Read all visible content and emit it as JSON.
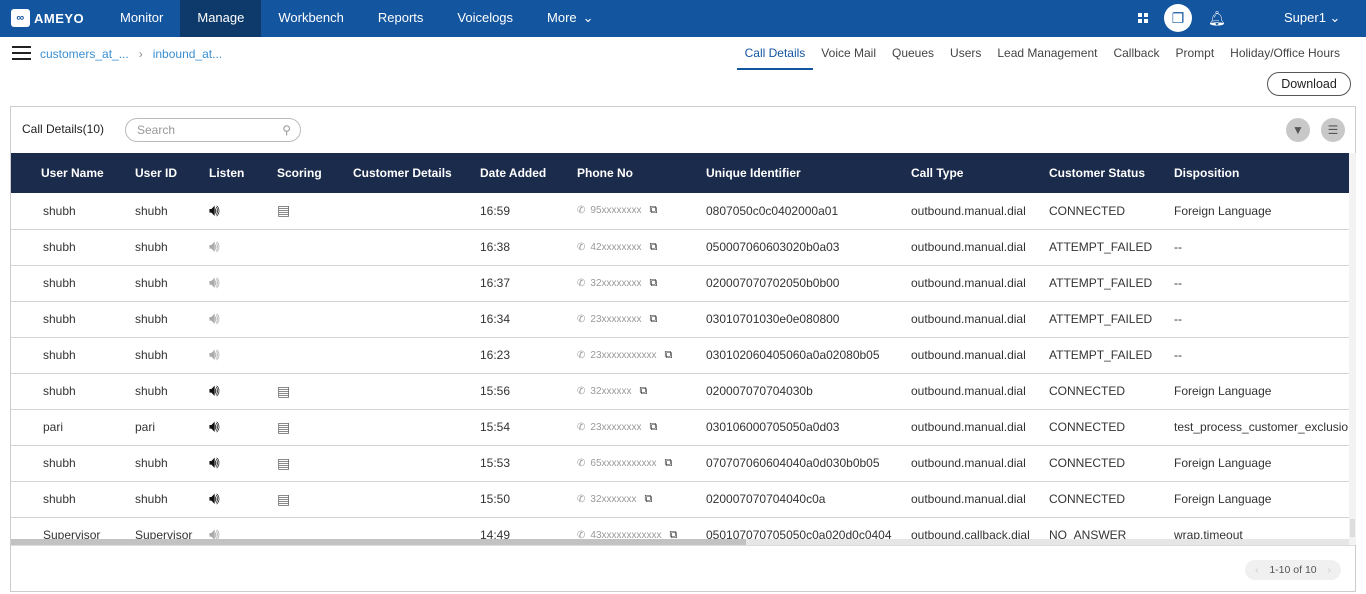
{
  "topbar": {
    "logo": "AMEYO",
    "nav": [
      "Monitor",
      "Manage",
      "Workbench",
      "Reports",
      "Voicelogs",
      "More"
    ],
    "active": "Manage",
    "user": "Super1"
  },
  "breadcrumb": [
    "customers_at_...",
    "inbound_at..."
  ],
  "tabs": [
    "Call Details",
    "Voice Mail",
    "Queues",
    "Users",
    "Lead Management",
    "Callback",
    "Prompt",
    "Holiday/Office Hours"
  ],
  "active_tab": "Call Details",
  "download_label": "Download",
  "card": {
    "title": "Call Details(10)",
    "search_placeholder": "Search"
  },
  "columns": [
    "User Name",
    "User ID",
    "Listen",
    "Scoring",
    "Customer Details",
    "Date Added",
    "Phone No",
    "Unique Identifier",
    "Call Type",
    "Customer Status",
    "Disposition"
  ],
  "rows": [
    {
      "user_name": "shubh",
      "user_id": "shubh",
      "listen_enabled": true,
      "scoring": true,
      "customer_details": "",
      "date_added": "16:59",
      "phone": "95xxxxxxxx",
      "uid": "0807050c0c0402000a01",
      "call_type": "outbound.manual.dial",
      "status": "CONNECTED",
      "disposition": "Foreign Language"
    },
    {
      "user_name": "shubh",
      "user_id": "shubh",
      "listen_enabled": false,
      "scoring": false,
      "customer_details": "",
      "date_added": "16:38",
      "phone": "42xxxxxxxx",
      "uid": "050007060603020b0a03",
      "call_type": "outbound.manual.dial",
      "status": "ATTEMPT_FAILED",
      "disposition": "--"
    },
    {
      "user_name": "shubh",
      "user_id": "shubh",
      "listen_enabled": false,
      "scoring": false,
      "customer_details": "",
      "date_added": "16:37",
      "phone": "32xxxxxxxx",
      "uid": "020007070702050b0b00",
      "call_type": "outbound.manual.dial",
      "status": "ATTEMPT_FAILED",
      "disposition": "--"
    },
    {
      "user_name": "shubh",
      "user_id": "shubh",
      "listen_enabled": false,
      "scoring": false,
      "customer_details": "",
      "date_added": "16:34",
      "phone": "23xxxxxxxx",
      "uid": "03010701030e0e080800",
      "call_type": "outbound.manual.dial",
      "status": "ATTEMPT_FAILED",
      "disposition": "--"
    },
    {
      "user_name": "shubh",
      "user_id": "shubh",
      "listen_enabled": false,
      "scoring": false,
      "customer_details": "",
      "date_added": "16:23",
      "phone": "23xxxxxxxxxxx",
      "uid": "030102060405060a0a02080b05",
      "call_type": "outbound.manual.dial",
      "status": "ATTEMPT_FAILED",
      "disposition": "--"
    },
    {
      "user_name": "shubh",
      "user_id": "shubh",
      "listen_enabled": true,
      "scoring": true,
      "customer_details": "",
      "date_added": "15:56",
      "phone": "32xxxxxx",
      "uid": "020007070704030b",
      "call_type": "outbound.manual.dial",
      "status": "CONNECTED",
      "disposition": "Foreign Language"
    },
    {
      "user_name": "pari",
      "user_id": "pari",
      "listen_enabled": true,
      "scoring": true,
      "customer_details": "",
      "date_added": "15:54",
      "phone": "23xxxxxxxx",
      "uid": "030106000705050a0d03",
      "call_type": "outbound.manual.dial",
      "status": "CONNECTED",
      "disposition": "test_process_customer_exclusio"
    },
    {
      "user_name": "shubh",
      "user_id": "shubh",
      "listen_enabled": true,
      "scoring": true,
      "customer_details": "",
      "date_added": "15:53",
      "phone": "65xxxxxxxxxxx",
      "uid": "070707060604040a0d030b0b05",
      "call_type": "outbound.manual.dial",
      "status": "CONNECTED",
      "disposition": "Foreign Language"
    },
    {
      "user_name": "shubh",
      "user_id": "shubh",
      "listen_enabled": true,
      "scoring": true,
      "customer_details": "",
      "date_added": "15:50",
      "phone": "32xxxxxxx",
      "uid": "020007070704040c0a",
      "call_type": "outbound.manual.dial",
      "status": "CONNECTED",
      "disposition": "Foreign Language"
    },
    {
      "user_name": "Supervisor",
      "user_id": "Supervisor",
      "listen_enabled": false,
      "scoring": false,
      "customer_details": "",
      "date_added": "14:49",
      "phone": "43xxxxxxxxxxxx",
      "uid": "050107070705050c0a020d0c0404",
      "call_type": "outbound.callback.dial",
      "status": "NO_ANSWER",
      "disposition": "wrap.timeout"
    }
  ],
  "pagination": "1-10 of 10",
  "colors": {
    "topbar": "#13559e",
    "nav_active": "#0e3a6b",
    "table_header": "#1b2b4b",
    "link": "#3a8fd2"
  }
}
